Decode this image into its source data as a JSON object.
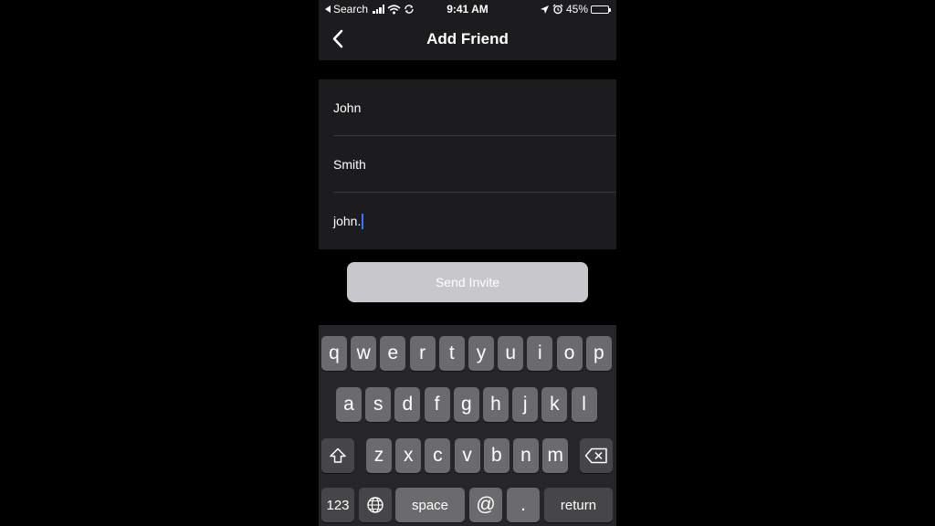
{
  "status_bar": {
    "back_app": "Search",
    "time": "9:41 AM",
    "battery": "45%",
    "battery_level": 0.45
  },
  "nav": {
    "title": "Add Friend",
    "back_icon": "chevron-left-icon"
  },
  "form": {
    "first_name": "John",
    "last_name": "Smith",
    "email": "john."
  },
  "send_button_label": "Send Invite",
  "keyboard": {
    "row1": [
      "q",
      "w",
      "e",
      "r",
      "t",
      "y",
      "u",
      "i",
      "o",
      "p"
    ],
    "row2": [
      "a",
      "s",
      "d",
      "f",
      "g",
      "h",
      "j",
      "k",
      "l"
    ],
    "row3": [
      "z",
      "x",
      "c",
      "v",
      "b",
      "n",
      "m"
    ],
    "numbers_label": "123",
    "space_label": "space",
    "at_label": "@",
    "dot_label": ".",
    "return_label": "return"
  },
  "colors": {
    "background": "#000000",
    "surface": "#1c1c1e",
    "caret": "#3478f6",
    "disabled_button": "#c7c7cc",
    "key": "#6b6b6d",
    "func_key": "#464648"
  }
}
